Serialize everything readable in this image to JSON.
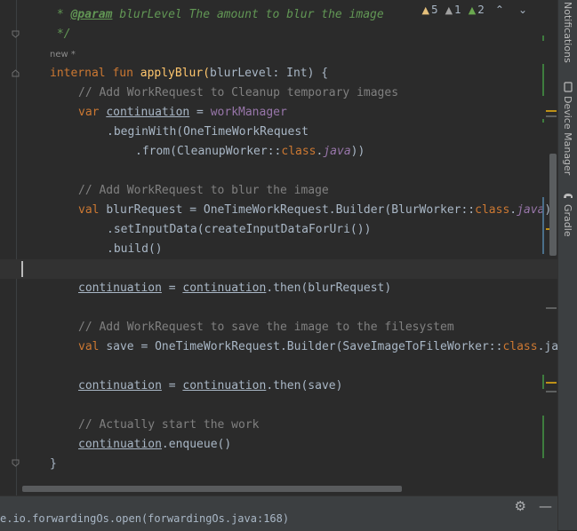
{
  "editor": {
    "inline_hint": "new *",
    "inspection": {
      "warnings": "5",
      "weak_warnings": "1",
      "ok": "2"
    },
    "lines": {
      "l1_star": " * ",
      "l1_tag": "@param",
      "l1_rest": " blurLevel The amount to blur the image",
      "l2": " */",
      "l3_kw1": "internal fun ",
      "l3_name": "applyBlur(",
      "l3_param": "blurLevel",
      "l3_rest": ": Int) {",
      "l4": "// Add WorkRequest to Cleanup temporary images",
      "l5_kw": "var ",
      "l5_var": "continuation",
      "l5_eq": " = ",
      "l5_prop": "workManager",
      "l6": ".beginWith(OneTimeWorkRequest",
      "l7_a": ".from(CleanupWorker::",
      "l7_kw": "class",
      "l7_b": ".",
      "l7_java": "java",
      "l7_c": "))",
      "l8": "// Add WorkRequest to blur the image",
      "l9_kw": "val ",
      "l9_a": "blurRequest = OneTimeWorkRequest.Builder(BlurWorker::",
      "l9_kw2": "class",
      "l9_b": ".",
      "l9_java": "java",
      "l9_c": ")",
      "l10": ".setInputData(createInputDataForUri())",
      "l11": ".build()",
      "l12_v1": "continuation",
      "l12_eq": " = ",
      "l12_v2": "continuation",
      "l12_rest": ".then(blurRequest)",
      "l13": "// Add WorkRequest to save the image to the filesystem",
      "l14_kw": "val ",
      "l14_a": "save = OneTimeWorkRequest.Builder(SaveImageToFileWorker::",
      "l14_kw2": "class",
      "l14_b": ".java)",
      "l15_v1": "continuation",
      "l15_eq": " = ",
      "l15_v2": "continuation",
      "l15_rest": ".then(save)",
      "l16": "// Actually start the work",
      "l17_v": "continuation",
      "l17_rest": ".enqueue()",
      "l18": "}"
    }
  },
  "console": {
    "text": "e.io.forwardingOs.open(forwardingOs.java:168)"
  },
  "side_panel": {
    "notifications": "Notifications",
    "device_manager": "Device Manager",
    "gradle": "Gradle"
  },
  "colors": {
    "editor_bg": "#2b2b2b",
    "keyword": "#cc7832",
    "comment": "#808080",
    "doc": "#629755",
    "warning": "#be9117"
  }
}
